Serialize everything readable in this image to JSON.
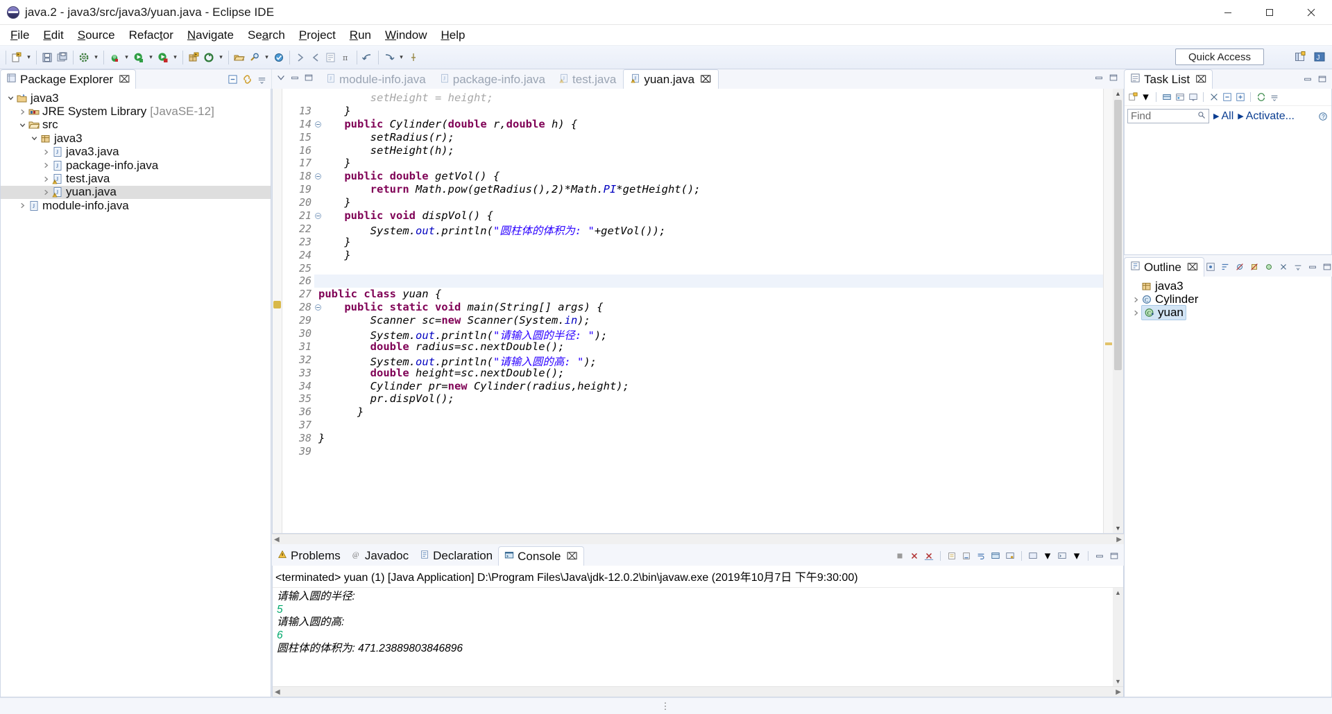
{
  "window": {
    "title": "java.2 - java3/src/java3/yuan.java - Eclipse IDE",
    "app_icon": "eclipse-icon",
    "minimize_label": "Minimize",
    "maximize_label": "Maximize",
    "close_label": "Close"
  },
  "menu": [
    {
      "label": "File"
    },
    {
      "label": "Edit"
    },
    {
      "label": "Source"
    },
    {
      "label": "Refactor"
    },
    {
      "label": "Navigate"
    },
    {
      "label": "Search"
    },
    {
      "label": "Project"
    },
    {
      "label": "Run"
    },
    {
      "label": "Window"
    },
    {
      "label": "Help"
    }
  ],
  "toolbar": {
    "quick_access": "Quick Access",
    "buttons": [
      {
        "name": "new-wizard-icon"
      },
      {
        "name": "save-icon"
      },
      {
        "name": "save-all-icon"
      },
      {
        "name": "build-icon"
      },
      {
        "name": "debug-icon"
      },
      {
        "name": "run-icon"
      },
      {
        "name": "run-coverage-icon"
      },
      {
        "name": "new-java-package-icon"
      },
      {
        "name": "external-tools-icon"
      },
      {
        "name": "open-type-icon"
      },
      {
        "name": "search-icon"
      },
      {
        "name": "next-annotation-icon"
      },
      {
        "name": "previous-annotation-icon"
      },
      {
        "name": "last-edit-location-icon"
      },
      {
        "name": "back-icon"
      },
      {
        "name": "forward-icon"
      },
      {
        "name": "pin-editor-icon"
      }
    ],
    "perspective": [
      {
        "name": "open-perspective-icon"
      },
      {
        "name": "java-perspective-icon"
      }
    ]
  },
  "package_explorer": {
    "title": "Package Explorer",
    "close_label": "⌧",
    "tools": [
      {
        "name": "collapse-all-icon"
      },
      {
        "name": "link-with-editor-icon"
      },
      {
        "name": "view-menu-icon"
      }
    ],
    "tree": [
      {
        "label": "java3",
        "indent": 0,
        "twisty": "down",
        "icon": "java-project-icon",
        "selected": false,
        "dim": ""
      },
      {
        "label": "JRE System Library",
        "indent": 1,
        "twisty": "right",
        "icon": "library-icon",
        "selected": false,
        "dim": "[JavaSE-12]"
      },
      {
        "label": "src",
        "indent": 1,
        "twisty": "down",
        "icon": "source-folder-icon",
        "selected": false,
        "dim": ""
      },
      {
        "label": "java3",
        "indent": 2,
        "twisty": "down",
        "icon": "package-icon",
        "selected": false,
        "dim": ""
      },
      {
        "label": "java3.java",
        "indent": 3,
        "twisty": "right",
        "icon": "java-file-icon",
        "selected": false,
        "dim": ""
      },
      {
        "label": "package-info.java",
        "indent": 3,
        "twisty": "right",
        "icon": "java-file-icon",
        "selected": false,
        "dim": ""
      },
      {
        "label": "test.java",
        "indent": 3,
        "twisty": "right",
        "icon": "java-file-warn-icon",
        "selected": false,
        "dim": ""
      },
      {
        "label": "yuan.java",
        "indent": 3,
        "twisty": "right",
        "icon": "java-file-warn-icon",
        "selected": true,
        "dim": ""
      },
      {
        "label": "module-info.java",
        "indent": 1,
        "twisty": "right",
        "icon": "java-file-icon",
        "selected": false,
        "dim": ""
      }
    ]
  },
  "editor": {
    "tabs": [
      {
        "label": "module-info.java",
        "active": false,
        "icon": "java-file-icon",
        "closable": false
      },
      {
        "label": "package-info.java",
        "active": false,
        "icon": "java-file-icon",
        "closable": false
      },
      {
        "label": "test.java",
        "active": false,
        "icon": "java-file-warn-icon",
        "closable": false
      },
      {
        "label": "yuan.java",
        "active": true,
        "icon": "java-file-warn-icon",
        "closable": true
      }
    ],
    "tab_close": "⌧",
    "lead_tools": [
      {
        "name": "view-menu-icon"
      },
      {
        "name": "minimize-icon"
      },
      {
        "name": "maximize-icon"
      }
    ],
    "right_tools": [
      {
        "name": "minimize-icon"
      },
      {
        "name": "maximize-icon"
      }
    ],
    "first_line_number": 13,
    "lines": [
      {
        "n": "",
        "fold": false,
        "partial": true,
        "segments": [
          {
            "t": "        setHeight = height;",
            "c": "plain"
          }
        ]
      },
      {
        "n": "13",
        "fold": false,
        "segments": [
          {
            "t": "    }",
            "c": "plain"
          }
        ]
      },
      {
        "n": "14",
        "fold": true,
        "segments": [
          {
            "t": "    ",
            "c": "plain"
          },
          {
            "t": "public",
            "c": "kw"
          },
          {
            "t": " Cylinder(",
            "c": "plain"
          },
          {
            "t": "double",
            "c": "kw"
          },
          {
            "t": " r,",
            "c": "plain"
          },
          {
            "t": "double",
            "c": "kw"
          },
          {
            "t": " h) {",
            "c": "plain"
          }
        ]
      },
      {
        "n": "15",
        "fold": false,
        "segments": [
          {
            "t": "        setRadius(r);",
            "c": "plain"
          }
        ]
      },
      {
        "n": "16",
        "fold": false,
        "segments": [
          {
            "t": "        setHeight(h);",
            "c": "plain"
          }
        ]
      },
      {
        "n": "17",
        "fold": false,
        "segments": [
          {
            "t": "    }",
            "c": "plain"
          }
        ]
      },
      {
        "n": "18",
        "fold": true,
        "segments": [
          {
            "t": "    ",
            "c": "plain"
          },
          {
            "t": "public double",
            "c": "kw"
          },
          {
            "t": " getVol() {",
            "c": "plain"
          }
        ]
      },
      {
        "n": "19",
        "fold": false,
        "segments": [
          {
            "t": "        ",
            "c": "plain"
          },
          {
            "t": "return",
            "c": "kw"
          },
          {
            "t": " Math.pow(getRadius(),2)*Math.",
            "c": "plain"
          },
          {
            "t": "PI",
            "c": "fld"
          },
          {
            "t": "*getHeight();",
            "c": "plain"
          }
        ]
      },
      {
        "n": "20",
        "fold": false,
        "segments": [
          {
            "t": "    }",
            "c": "plain"
          }
        ]
      },
      {
        "n": "21",
        "fold": true,
        "segments": [
          {
            "t": "    ",
            "c": "plain"
          },
          {
            "t": "public void",
            "c": "kw"
          },
          {
            "t": " dispVol() {",
            "c": "plain"
          }
        ]
      },
      {
        "n": "22",
        "fold": false,
        "segments": [
          {
            "t": "        System.",
            "c": "plain"
          },
          {
            "t": "out",
            "c": "fld"
          },
          {
            "t": ".println(",
            "c": "plain"
          },
          {
            "t": "\"圆柱体的体积为: \"",
            "c": "str"
          },
          {
            "t": "+getVol());",
            "c": "plain"
          }
        ]
      },
      {
        "n": "23",
        "fold": false,
        "segments": [
          {
            "t": "    }",
            "c": "plain"
          }
        ]
      },
      {
        "n": "24",
        "fold": false,
        "segments": [
          {
            "t": "    }",
            "c": "plain"
          }
        ]
      },
      {
        "n": "25",
        "fold": false,
        "segments": [
          {
            "t": "",
            "c": "plain"
          }
        ]
      },
      {
        "n": "26",
        "fold": false,
        "highlight": true,
        "segments": [
          {
            "t": "",
            "c": "plain"
          }
        ]
      },
      {
        "n": "27",
        "fold": false,
        "segments": [
          {
            "t": "public class",
            "c": "kw"
          },
          {
            "t": " yuan {",
            "c": "plain"
          }
        ]
      },
      {
        "n": "28",
        "fold": true,
        "segments": [
          {
            "t": "    ",
            "c": "plain"
          },
          {
            "t": "public static void",
            "c": "kw"
          },
          {
            "t": " main(String[] args) {",
            "c": "plain"
          }
        ]
      },
      {
        "n": "29",
        "fold": false,
        "segments": [
          {
            "t": "        Scanner sc=",
            "c": "plain"
          },
          {
            "t": "new",
            "c": "kw"
          },
          {
            "t": " Scanner(System.",
            "c": "plain"
          },
          {
            "t": "in",
            "c": "fld"
          },
          {
            "t": ");",
            "c": "plain"
          }
        ]
      },
      {
        "n": "30",
        "fold": false,
        "segments": [
          {
            "t": "        System.",
            "c": "plain"
          },
          {
            "t": "out",
            "c": "fld"
          },
          {
            "t": ".println(",
            "c": "plain"
          },
          {
            "t": "\"请输入圆的半径: \"",
            "c": "str"
          },
          {
            "t": ");",
            "c": "plain"
          }
        ]
      },
      {
        "n": "31",
        "fold": false,
        "segments": [
          {
            "t": "        ",
            "c": "plain"
          },
          {
            "t": "double",
            "c": "kw"
          },
          {
            "t": " radius=sc.nextDouble();",
            "c": "plain"
          }
        ]
      },
      {
        "n": "32",
        "fold": false,
        "segments": [
          {
            "t": "        System.",
            "c": "plain"
          },
          {
            "t": "out",
            "c": "fld"
          },
          {
            "t": ".println(",
            "c": "plain"
          },
          {
            "t": "\"请输入圆的高: \"",
            "c": "str"
          },
          {
            "t": ");",
            "c": "plain"
          }
        ]
      },
      {
        "n": "33",
        "fold": false,
        "segments": [
          {
            "t": "        ",
            "c": "plain"
          },
          {
            "t": "double",
            "c": "kw"
          },
          {
            "t": " height=sc.nextDouble();",
            "c": "plain"
          }
        ]
      },
      {
        "n": "34",
        "fold": false,
        "segments": [
          {
            "t": "        Cylinder pr=",
            "c": "plain"
          },
          {
            "t": "new",
            "c": "kw"
          },
          {
            "t": " Cylinder(radius,height);",
            "c": "plain"
          }
        ]
      },
      {
        "n": "35",
        "fold": false,
        "segments": [
          {
            "t": "        pr.dispVol();",
            "c": "plain"
          }
        ]
      },
      {
        "n": "36",
        "fold": false,
        "segments": [
          {
            "t": "      }",
            "c": "plain"
          }
        ]
      },
      {
        "n": "37",
        "fold": false,
        "segments": [
          {
            "t": "",
            "c": "plain"
          }
        ]
      },
      {
        "n": "38",
        "fold": false,
        "segments": [
          {
            "t": "}",
            "c": "plain"
          }
        ]
      },
      {
        "n": "39",
        "fold": false,
        "segments": [
          {
            "t": "",
            "c": "plain"
          }
        ]
      }
    ]
  },
  "bottom_panel": {
    "tabs": [
      {
        "label": "Problems",
        "active": false,
        "icon": "problems-icon",
        "closable": false
      },
      {
        "label": "Javadoc",
        "active": false,
        "icon": "javadoc-icon",
        "closable": false
      },
      {
        "label": "Declaration",
        "active": false,
        "icon": "declaration-icon",
        "closable": false
      },
      {
        "label": "Console",
        "active": true,
        "icon": "console-icon",
        "closable": true
      }
    ],
    "tab_close": "⌧",
    "tools": [
      {
        "name": "terminate-icon"
      },
      {
        "name": "remove-launch-icon"
      },
      {
        "name": "remove-all-terminated-icon"
      },
      {
        "name": "clear-console-icon"
      },
      {
        "name": "scroll-lock-icon"
      },
      {
        "name": "word-wrap-icon"
      },
      {
        "name": "show-console-on-output-icon"
      },
      {
        "name": "pin-console-icon"
      },
      {
        "name": "display-selected-console-icon"
      },
      {
        "name": "open-console-icon"
      },
      {
        "name": "minimize-icon"
      },
      {
        "name": "maximize-icon"
      }
    ],
    "console": {
      "header": "<terminated> yuan (1) [Java Application] D:\\Program Files\\Java\\jdk-12.0.2\\bin\\javaw.exe (2019年10月7日 下午9:30:00)",
      "output": [
        {
          "text": "请输入圆的半径:",
          "kind": "out"
        },
        {
          "text": "5",
          "kind": "in"
        },
        {
          "text": "请输入圆的高:",
          "kind": "out"
        },
        {
          "text": "6",
          "kind": "in"
        },
        {
          "text": "圆柱体的体积为: 471.23889803846896",
          "kind": "out"
        }
      ]
    }
  },
  "task_list": {
    "title": "Task List",
    "close_label": "⌧",
    "tools": [
      {
        "name": "new-task-icon"
      },
      {
        "name": "categorize-icon"
      },
      {
        "name": "schedule-icon"
      },
      {
        "name": "presentation-icon"
      },
      {
        "name": "focus-icon"
      },
      {
        "name": "collapse-all-icon"
      },
      {
        "name": "expand-all-icon"
      },
      {
        "name": "synchronize-icon"
      },
      {
        "name": "view-menu-icon"
      },
      {
        "name": "minimize-icon"
      },
      {
        "name": "maximize-icon"
      }
    ],
    "find_placeholder": "Find",
    "find_value": "",
    "find_icon": "search-icon",
    "all_label": "All",
    "activate_label": "Activate...",
    "help_icon": "help-icon"
  },
  "outline": {
    "title": "Outline",
    "close_label": "⌧",
    "tools": [
      {
        "name": "focus-icon"
      },
      {
        "name": "sort-icon"
      },
      {
        "name": "hide-fields-icon"
      },
      {
        "name": "hide-static-icon"
      },
      {
        "name": "hide-nonpublic-icon"
      },
      {
        "name": "hide-local-types-icon"
      },
      {
        "name": "view-menu-icon"
      },
      {
        "name": "minimize-icon"
      },
      {
        "name": "maximize-icon"
      }
    ],
    "items": [
      {
        "label": "java3",
        "icon": "package-icon",
        "twisty": "none",
        "selected": false
      },
      {
        "label": "Cylinder",
        "icon": "class-icon",
        "twisty": "right",
        "selected": false
      },
      {
        "label": "yuan",
        "icon": "public-class-icon",
        "twisty": "right",
        "selected": true
      }
    ]
  },
  "status_bar": {
    "grip": "⋮"
  },
  "colors": {
    "accent": "#0a3d91",
    "keyword": "#7f0055",
    "string": "#2a00ff",
    "field": "#0000c0",
    "line_number": "#808080",
    "console_input": "#00a86b",
    "selection": "#d3e5f5"
  }
}
